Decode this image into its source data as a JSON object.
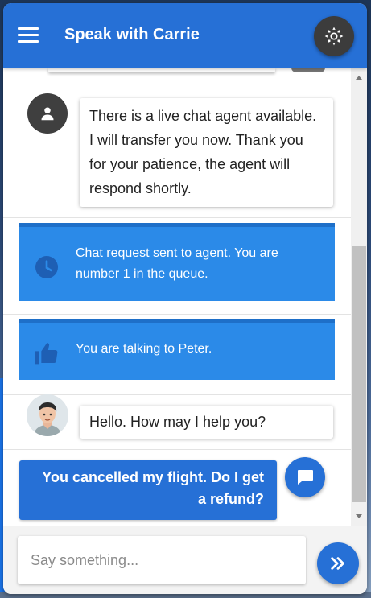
{
  "header": {
    "title": "Speak with Carrie",
    "menu_icon": "hamburger-menu-icon",
    "settings_icon": "brightness-icon"
  },
  "messages": [
    {
      "type": "bot",
      "avatar_icon": "person-icon",
      "text": "There is a live chat agent available. I will transfer you now. Thank you for your patience, the agent will respond shortly."
    },
    {
      "type": "system",
      "icon": "clock-icon",
      "text": "Chat request sent to agent. You are number 1 in the queue."
    },
    {
      "type": "system",
      "icon": "thumbs-up-icon",
      "text": "You are talking to Peter."
    },
    {
      "type": "agent",
      "avatar_icon": "agent-avatar",
      "text": "Hello. How may I help you?"
    },
    {
      "type": "user",
      "avatar_icon": "chat-bubble-icon",
      "text": "You cancelled my flight. Do I get a refund?"
    }
  ],
  "composer": {
    "placeholder": "Say something...",
    "value": "",
    "send_icon": "double-chevron-right-icon"
  },
  "colors": {
    "primary": "#2670d6",
    "info_card": "#2b8ae8",
    "settings_button": "#3c3c3c"
  }
}
